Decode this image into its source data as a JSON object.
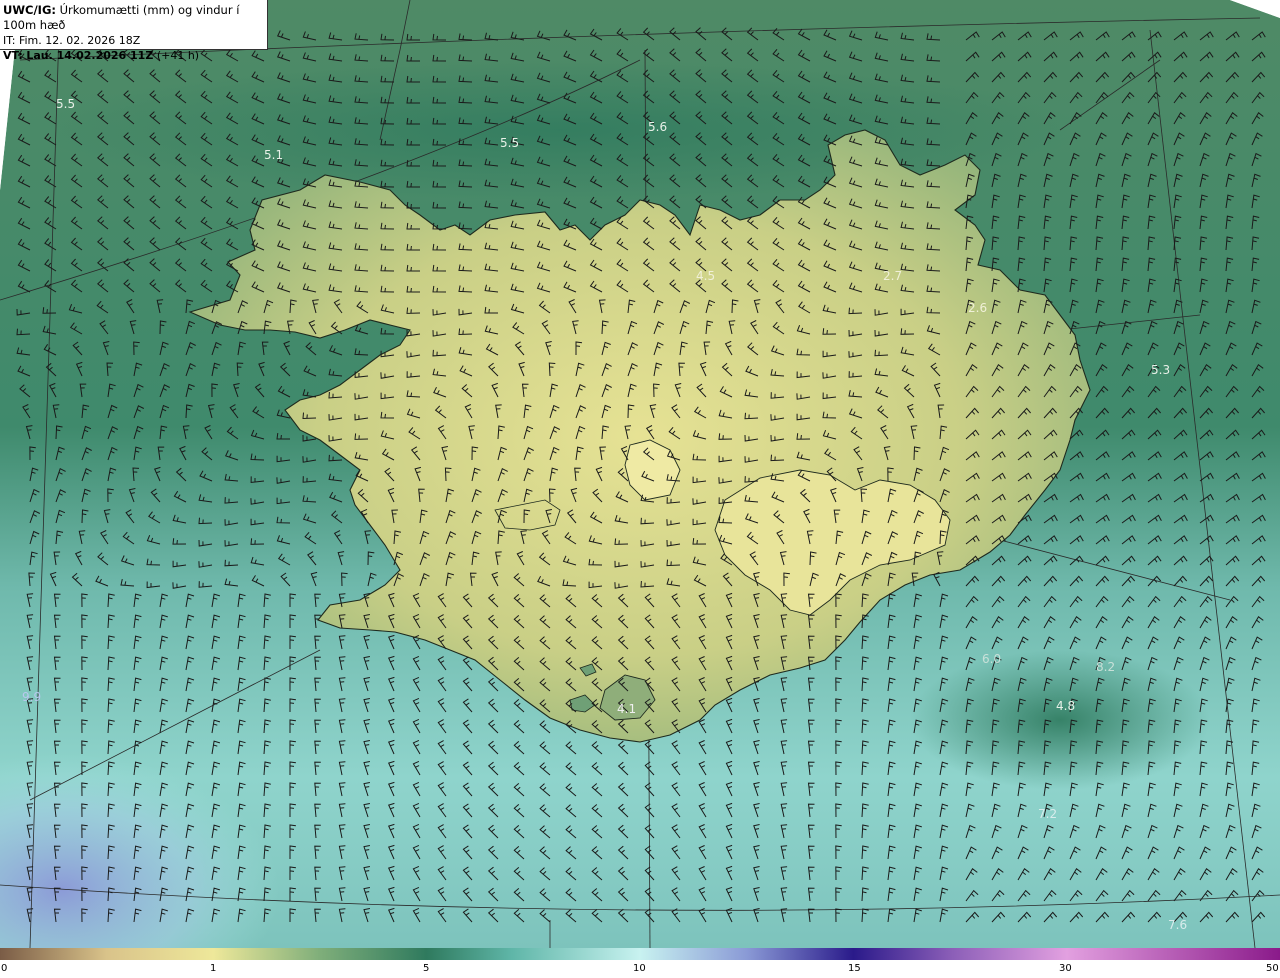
{
  "header": {
    "model": "UWC/IG:",
    "title": "Úrkomumætti (mm) og vindur í 100m hæð",
    "it_line": "IT: Fim. 12. 02. 2026 18Z",
    "vt_prefix": "VT:",
    "vt_value": "Lau. 14.02.2026 11Z",
    "vt_offset": "(+41 h)"
  },
  "colorbar": {
    "ticks": [
      "0",
      "1",
      "5",
      "10",
      "15",
      "30",
      "50"
    ],
    "stops": [
      {
        "v": 0,
        "color": "#7a5c46"
      },
      {
        "v": 0.5,
        "color": "#d9c38a"
      },
      {
        "v": 1,
        "color": "#eee89a"
      },
      {
        "v": 3,
        "color": "#7fae7a"
      },
      {
        "v": 5,
        "color": "#2f7a5e"
      },
      {
        "v": 7,
        "color": "#5fb6a8"
      },
      {
        "v": 10,
        "color": "#c8f2f0"
      },
      {
        "v": 12.5,
        "color": "#8a9ad6"
      },
      {
        "v": 15,
        "color": "#2a1a8a"
      },
      {
        "v": 22,
        "color": "#8c5fb8"
      },
      {
        "v": 30,
        "color": "#e2a0e0"
      },
      {
        "v": 50,
        "color": "#8a1a8a"
      }
    ]
  },
  "map_labels": [
    {
      "text": "5.5",
      "color": "#e8f0e8"
    },
    {
      "text": "5.1",
      "color": "#e8f0e8"
    },
    {
      "text": "5.5",
      "color": "#e8f0e8"
    },
    {
      "text": "5.6",
      "color": "#e8f0e8"
    },
    {
      "text": "4.5",
      "color": "#f0f0d8"
    },
    {
      "text": "2.7",
      "color": "#f0f0d8"
    },
    {
      "text": "2.6",
      "color": "#f0f0d8"
    },
    {
      "text": "5.3",
      "color": "#e8f0e8"
    },
    {
      "text": "6.0",
      "color": "#c8e0d8"
    },
    {
      "text": "8.2",
      "color": "#c8e0d8"
    },
    {
      "text": "4.8",
      "color": "#e8f0e8"
    },
    {
      "text": "4.1",
      "color": "#f0f0f0"
    },
    {
      "text": "7.2",
      "color": "#d8ecec"
    },
    {
      "text": "7.6",
      "color": "#d8ecec"
    },
    {
      "text": "9.9",
      "color": "#b8c8ee"
    }
  ]
}
